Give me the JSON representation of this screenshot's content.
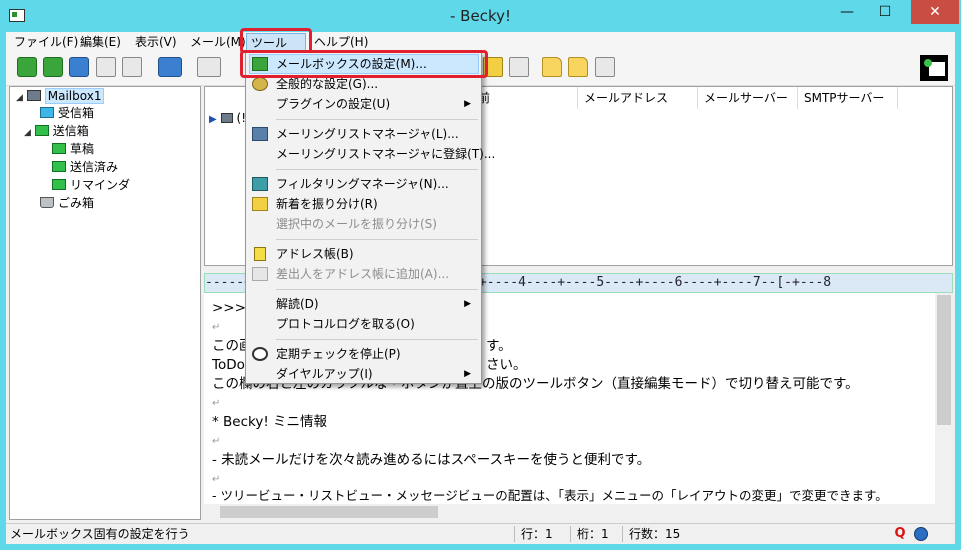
{
  "window": {
    "title": "- Becky!",
    "minimize": "—",
    "maximize": "☐",
    "close": "✕"
  },
  "menubar": [
    {
      "label": "ファイル(F)"
    },
    {
      "label": "編集(E)"
    },
    {
      "label": "表示(V)"
    },
    {
      "label": "メール(M)"
    },
    {
      "label": "ツール(T)"
    },
    {
      "label": "ヘルプ(H)"
    }
  ],
  "tree": {
    "root": "Mailbox1",
    "items": [
      "受信箱",
      "送信箱",
      "草稿",
      "送信済み",
      "リマインダ",
      "ごみ箱"
    ]
  },
  "list": {
    "columns": [
      "前",
      "メールアドレス",
      "メールサーバー",
      "SMTPサーバー"
    ],
    "row_prefix": "(!"
  },
  "ruler": "-----+----1----+----2----+----3----+----4----+----5----+----6----+----7--[-+---8",
  "preview": {
    "lines": [
      ">>>",
      "",
      "この画",
      "ToDo",
      "この欄の右と左のカラフルな・ボタンが直上の版のツールボタン（直接編集モード）で切り替え可能です。",
      "",
      "* Becky! ミニ情報",
      "",
      "- 未読メールだけを次々読み進めるにはスペースキーを使うと便利です。",
      "",
      "- ツリービュー・リストビュー・メッセージビューの配置は、「表示」メニューの「レイアウトの変更」で変更できます。"
    ],
    "line3_tail": "す。",
    "line4_tail": "さい。"
  },
  "dropdown": {
    "items": [
      {
        "label": "メールボックスの設定(M)...",
        "icon": "mailbox-settings-icon",
        "disabled": false
      },
      {
        "label": "全般的な設定(G)...",
        "icon": "general-settings-icon",
        "disabled": false
      },
      {
        "label": "プラグインの設定(U)",
        "submenu": true,
        "disabled": false
      },
      {
        "label": "メーリングリストマネージャ(L)...",
        "icon": "mailing-list-icon",
        "disabled": false
      },
      {
        "label": "メーリングリストマネージャに登録(T)...",
        "disabled": false
      },
      {
        "label": "フィルタリングマネージャ(N)...",
        "icon": "filter-icon",
        "disabled": false
      },
      {
        "label": "新着を振り分け(R)",
        "icon": "sort-new-icon",
        "disabled": false
      },
      {
        "label": "選択中のメールを振り分け(S)",
        "disabled": true
      },
      {
        "label": "アドレス帳(B)",
        "icon": "address-book-icon",
        "disabled": false
      },
      {
        "label": "差出人をアドレス帳に追加(A)...",
        "icon": "add-address-icon",
        "disabled": true
      },
      {
        "label": "解読(D)",
        "submenu": true,
        "disabled": false
      },
      {
        "label": "プロトコルログを取る(O)",
        "disabled": false
      },
      {
        "label": "定期チェックを停止(P)",
        "icon": "stop-check-icon",
        "disabled": false
      },
      {
        "label": "ダイヤルアップ(I)",
        "submenu": true,
        "disabled": false
      }
    ]
  },
  "status": {
    "message": "メールボックス固有の設定を行う",
    "line": "行：1",
    "column": "桁：1",
    "count": "行数：15",
    "q_icon": "Q"
  },
  "colors": {
    "accent": "#e0202f",
    "titlebar": "#5fd9e9",
    "highlight": "#cce8ff"
  }
}
